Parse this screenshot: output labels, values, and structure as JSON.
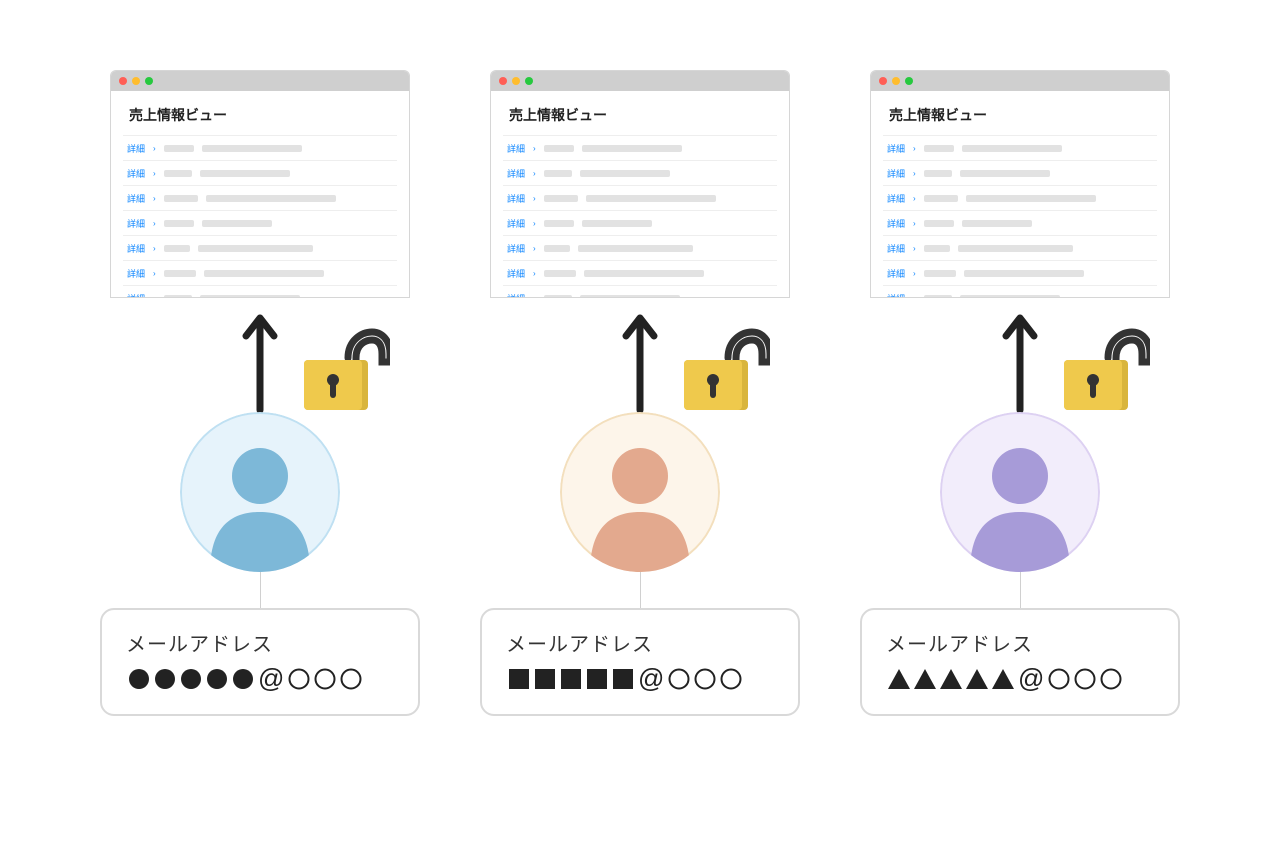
{
  "columns": [
    {
      "view_title": "売上情報ビュー",
      "detail_label": "詳細",
      "avatar": {
        "bg": "#e6f3fb",
        "ring": "#bfe0f2",
        "person": "#7db8d8"
      },
      "email_label": "メールアドレス",
      "mask_shape": "circle",
      "mask_count": 5,
      "domain_count": 3
    },
    {
      "view_title": "売上情報ビュー",
      "detail_label": "詳細",
      "avatar": {
        "bg": "#fdf5ea",
        "ring": "#f3dfbd",
        "person": "#e3a98e"
      },
      "email_label": "メールアドレス",
      "mask_shape": "square",
      "mask_count": 5,
      "domain_count": 3
    },
    {
      "view_title": "売上情報ビュー",
      "detail_label": "詳細",
      "avatar": {
        "bg": "#f2edfb",
        "ring": "#ddd1f2",
        "person": "#a79bd8"
      },
      "email_label": "メールアドレス",
      "mask_shape": "triangle",
      "mask_count": 5,
      "domain_count": 3
    }
  ],
  "row_bars": [
    [
      30,
      100
    ],
    [
      28,
      90
    ],
    [
      34,
      130
    ],
    [
      30,
      70
    ],
    [
      26,
      115
    ],
    [
      32,
      120
    ],
    [
      28,
      100
    ]
  ],
  "colors": {
    "lock_body": "#efc94c",
    "lock_shackle": "#333333",
    "arrow": "#222222",
    "glyph_fill": "#222222",
    "glyph_stroke": "#222222"
  }
}
